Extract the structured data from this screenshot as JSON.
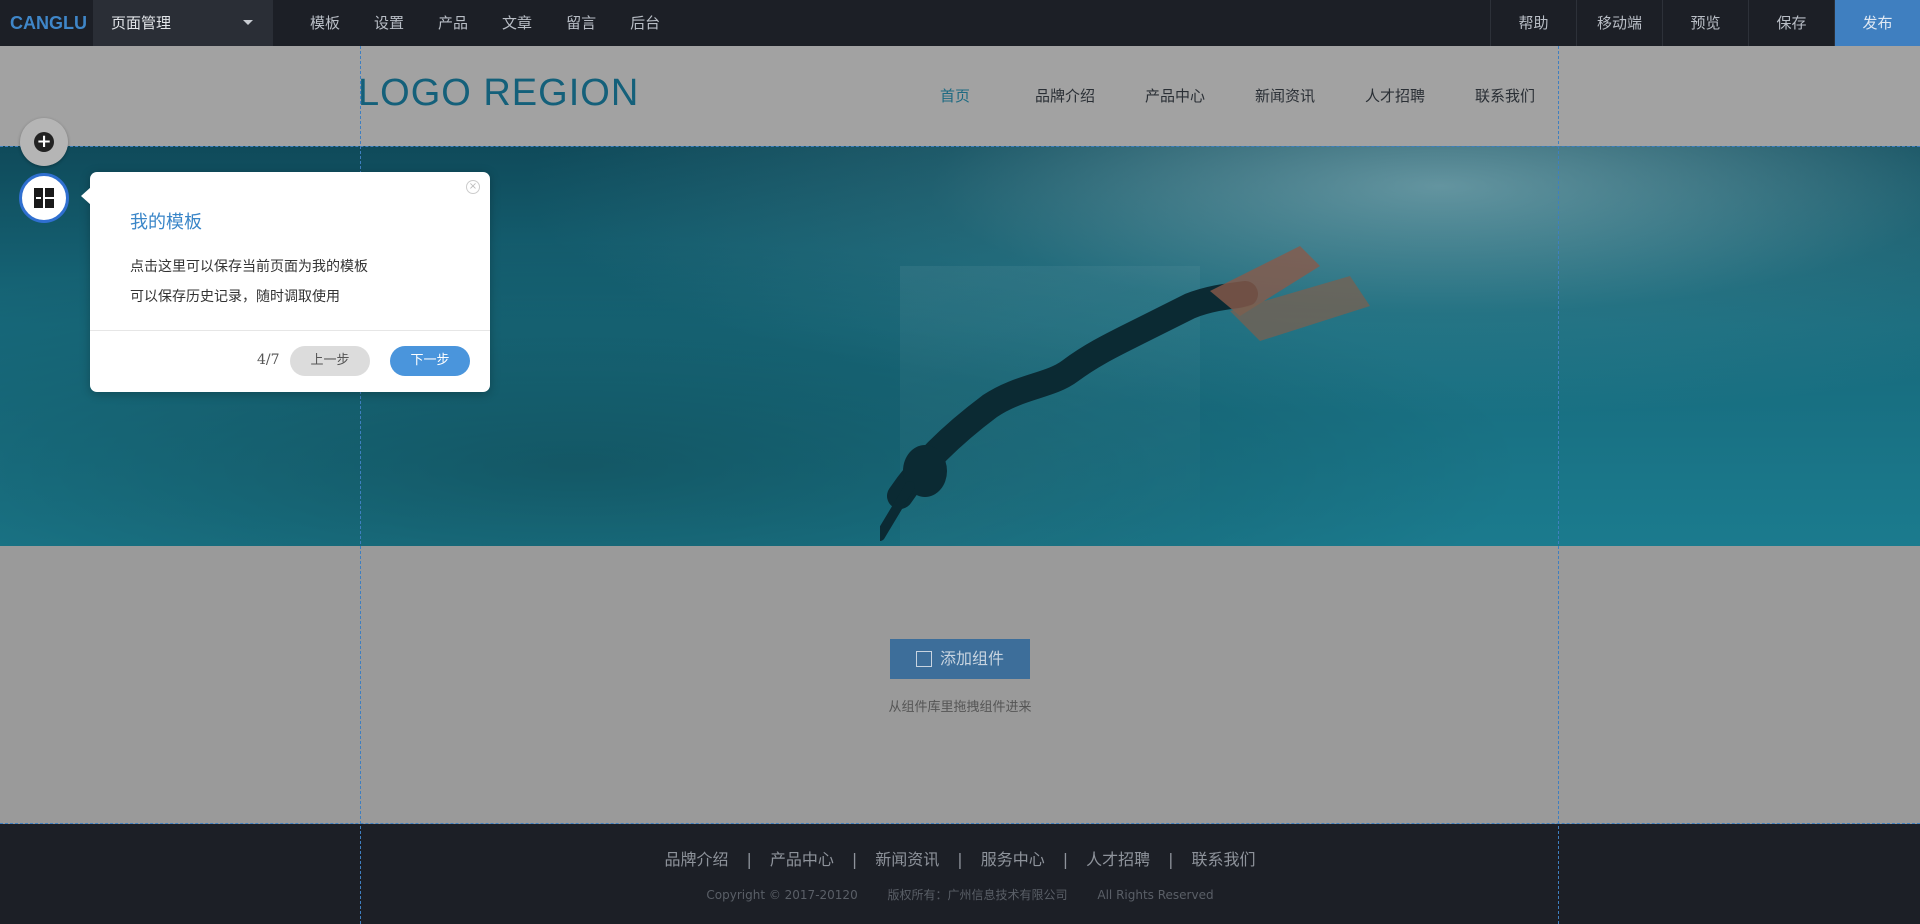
{
  "topbar": {
    "brand": "CANGLU",
    "page_select": "页面管理",
    "nav": [
      "模板",
      "设置",
      "产品",
      "文章",
      "留言",
      "后台"
    ],
    "right": [
      "帮助",
      "移动端",
      "预览",
      "保存",
      "发布"
    ]
  },
  "site": {
    "logo": "LOGO REGION",
    "nav": [
      {
        "label": "首页",
        "active": true
      },
      {
        "label": "品牌介绍",
        "active": false
      },
      {
        "label": "产品中心",
        "active": false
      },
      {
        "label": "新闻资讯",
        "active": false
      },
      {
        "label": "人才招聘",
        "active": false
      },
      {
        "label": "联系我们",
        "active": false
      }
    ]
  },
  "content": {
    "add_button": "添加组件",
    "hint": "从组件库里拖拽组件进来"
  },
  "footer": {
    "links": [
      "品牌介绍",
      "产品中心",
      "新闻资讯",
      "服务中心",
      "人才招聘",
      "联系我们"
    ],
    "separator": "|",
    "copyright": "Copyright © 2017-20120",
    "rights_owner": "版权所有：广州信息技术有限公司",
    "rights": "All Rights Reserved"
  },
  "popover": {
    "title": "我的模板",
    "line1": "点击这里可以保存当前页面为我的模板",
    "line2": "可以保存历史记录，随时调取使用",
    "step": "4/7",
    "prev": "上一步",
    "next": "下一步",
    "close_icon": "close-icon"
  },
  "colors": {
    "accent": "#3f7fc0",
    "brand": "#3f86c8",
    "next_button": "#4a95dc"
  }
}
